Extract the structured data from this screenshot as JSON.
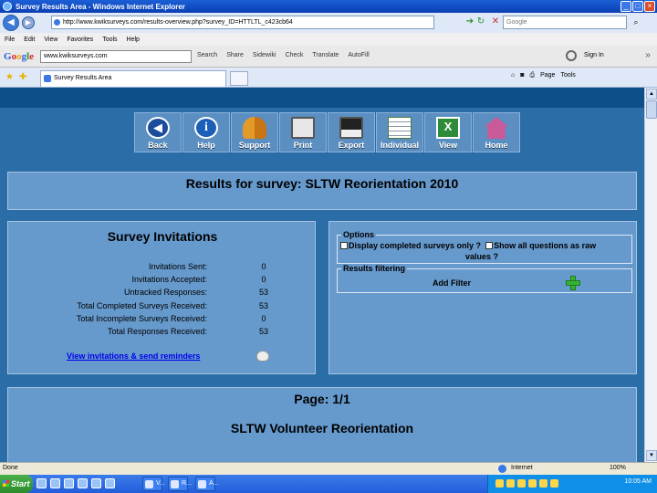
{
  "window": {
    "title": "Survey Results Area - Windows Internet Explorer"
  },
  "address_bar": {
    "url": "http://www.kwiksurveys.com/results-overview.php?survey_ID=HTTLTL_c423cb64",
    "search_placeholder": "Google"
  },
  "menu": [
    "File",
    "Edit",
    "View",
    "Favorites",
    "Tools",
    "Help"
  ],
  "google_toolbar": {
    "search_value": "www.kwiksurveys.com",
    "items": [
      "Search",
      "Share",
      "Sidewiki",
      "Check",
      "Translate",
      "AutoFill"
    ],
    "signin": "Sign In"
  },
  "tab": {
    "label": "Survey Results Area",
    "tools": [
      "Page",
      "Tools"
    ]
  },
  "toolbar_buttons": [
    {
      "label": "Back",
      "icon": "back-arrow-icon"
    },
    {
      "label": "Help",
      "icon": "info-icon"
    },
    {
      "label": "Support",
      "icon": "people-icon"
    },
    {
      "label": "Print",
      "icon": "printer-icon"
    },
    {
      "label": "Export",
      "icon": "floppy-disk-icon"
    },
    {
      "label": "Individual",
      "icon": "sheet-icon"
    },
    {
      "label": "View",
      "icon": "excel-icon"
    },
    {
      "label": "Home",
      "icon": "house-icon"
    }
  ],
  "results": {
    "title": "Results for survey: SLTW Reorientation 2010"
  },
  "invitations": {
    "heading": "Survey Invitations",
    "rows": [
      {
        "label": "Invitations Sent:",
        "value": "0"
      },
      {
        "label": "Invitations Accepted:",
        "value": "0"
      },
      {
        "label": "Untracked Responses:",
        "value": "53"
      },
      {
        "label": "Total Completed Surveys Received:",
        "value": "53"
      },
      {
        "label": "Total Incomplete Surveys Received:",
        "value": "0"
      },
      {
        "label": "Total Responses Received:",
        "value": "53"
      }
    ],
    "link": "View invitations & send reminders"
  },
  "options": {
    "legend": "Options",
    "display_completed": "Display completed surveys only ?",
    "show_raw_1": "Show all questions as raw",
    "show_raw_2": "values ?"
  },
  "filtering": {
    "legend": "Results filtering",
    "add_filter": "Add Filter"
  },
  "page": {
    "indicator": "Page: 1/1",
    "survey_title": "SLTW Volunteer Reorientation"
  },
  "status": {
    "left": "Done",
    "zone": "Internet",
    "zoom": "100%"
  },
  "taskbar": {
    "start": "Start",
    "tasks": [
      "V...",
      "R...",
      "A..."
    ],
    "clock": "10:05 AM"
  },
  "colors": {
    "content_bg": "#2b6ea7",
    "panel_bg": "#6699cc",
    "link": "#0000ee"
  }
}
